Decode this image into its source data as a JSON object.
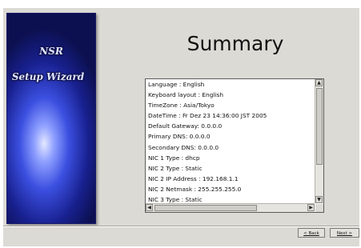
{
  "brand": {
    "title": "NSR",
    "subtitle": "Setup Wizard"
  },
  "page_title": "Summary",
  "summary_lines": [
    "Language : English",
    "Keyboard layout : English",
    "TimeZone : Asia/Tokyo",
    "DateTime : Fr Dez 23 14:36:00 JST 2005",
    "Default Gateway: 0.0.0.0",
    "Primary DNS: 0.0.0.0",
    "Secondary DNS: 0.0.0.0",
    "NIC 1 Type : dhcp",
    "NIC 2 Type : Static",
    "NIC 2 IP Address : 192.168.1.1",
    "NIC 2 Netmask : 255.255.255.0",
    "NIC 3 Type : Static"
  ],
  "buttons": {
    "back": "< Back",
    "next": "Next >"
  },
  "icons": {
    "scroll_up": "arrow-up-icon",
    "scroll_down": "arrow-down-icon",
    "scroll_left": "arrow-left-icon",
    "scroll_right": "arrow-right-icon"
  }
}
